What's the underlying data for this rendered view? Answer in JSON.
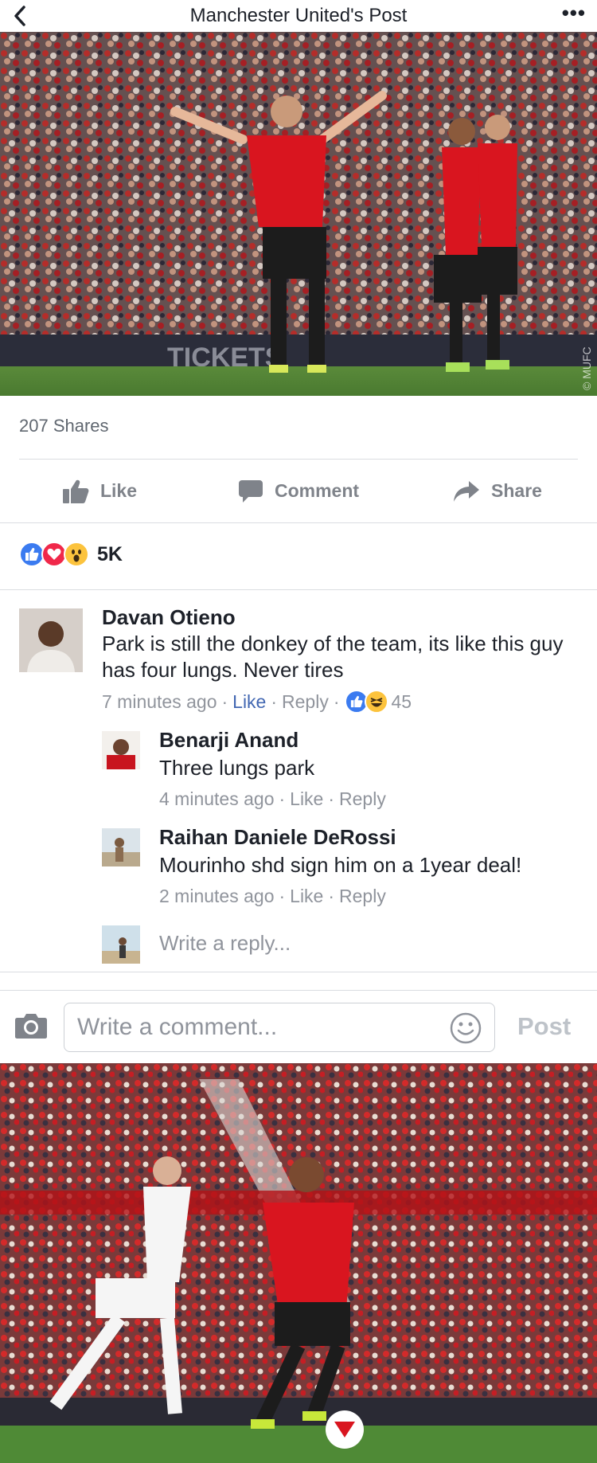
{
  "header": {
    "title": "Manchester United's Post",
    "more": "•••"
  },
  "post": {
    "shares_text": "207 Shares",
    "actions": {
      "like": "Like",
      "comment": "Comment",
      "share": "Share"
    },
    "reactions_count": "5K",
    "photo_watermark": "© MUFC"
  },
  "comments": [
    {
      "name": "Davan Otieno",
      "text": "Park is still the donkey of the team, its like this guy has four lungs. Never tires",
      "time": "7 minutes ago",
      "like": "Like",
      "reply": "Reply",
      "reaction_count": "45",
      "replies": [
        {
          "name": "Benarji Anand",
          "text": "Three lungs park",
          "time": "4 minutes ago",
          "like": "Like",
          "reply": "Reply"
        },
        {
          "name": "Raihan Daniele DeRossi",
          "text": "Mourinho shd sign him on a 1year deal!",
          "time": "2 minutes ago",
          "like": "Like",
          "reply": "Reply"
        }
      ],
      "write_reply_placeholder": "Write a reply..."
    }
  ],
  "composer": {
    "placeholder": "Write a comment...",
    "post_label": "Post"
  },
  "colors": {
    "link_blue": "#4267b2",
    "like_blue": "#3b7bf0",
    "love_red": "#f0284a",
    "haha_yellow": "#fcc33d",
    "man_utd_red": "#d9151f"
  },
  "icons": [
    "back-chevron-icon",
    "more-dots-icon",
    "thumbs-up-icon",
    "comment-bubble-icon",
    "share-arrow-icon",
    "like-reaction-icon",
    "love-reaction-icon",
    "wow-reaction-icon",
    "haha-reaction-icon",
    "camera-icon",
    "smiley-icon"
  ]
}
